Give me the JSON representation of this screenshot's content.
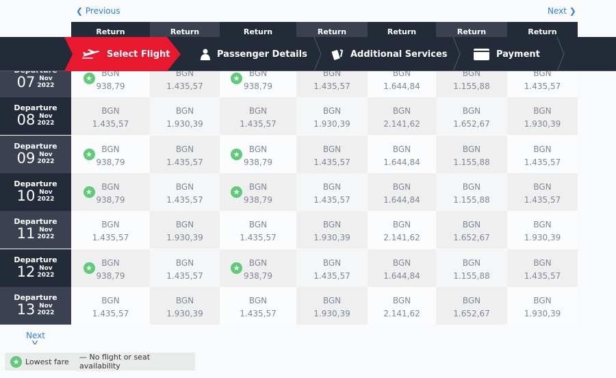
{
  "pagination": {
    "previous": "Previous",
    "next": "Next",
    "next_bottom": "Next"
  },
  "return_header": "Return",
  "steps": [
    {
      "label": "Select Flight",
      "icon": "airplane-icon",
      "active": true
    },
    {
      "label": "Passenger Details",
      "icon": "person-icon"
    },
    {
      "label": "Additional Services",
      "icon": "tickets-icon"
    },
    {
      "label": "Payment",
      "icon": "credit-card-icon"
    }
  ],
  "departure_label": "Departure",
  "currency": "BGN",
  "rows": [
    {
      "day": "07",
      "month": "Nov",
      "year": "2022",
      "fares": [
        "938,79",
        "1.435,57",
        "938,79",
        "1.435,57",
        "1.644,84",
        "1.155,88",
        "1.435,57"
      ],
      "lowest": [
        0,
        2
      ]
    },
    {
      "day": "08",
      "month": "Nov",
      "year": "2022",
      "fares": [
        "1.435,57",
        "1.930,39",
        "1.435,57",
        "1.930,39",
        "2.141,62",
        "1.652,67",
        "1.930,39"
      ],
      "lowest": []
    },
    {
      "day": "09",
      "month": "Nov",
      "year": "2022",
      "fares": [
        "938,79",
        "1.435,57",
        "938,79",
        "1.435,57",
        "1.644,84",
        "1.155,88",
        "1.435,57"
      ],
      "lowest": [
        0,
        2
      ]
    },
    {
      "day": "10",
      "month": "Nov",
      "year": "2022",
      "fares": [
        "938,79",
        "1.435,57",
        "938,79",
        "1.435,57",
        "1.644,84",
        "1.155,88",
        "1.435,57"
      ],
      "lowest": [
        0,
        2
      ]
    },
    {
      "day": "11",
      "month": "Nov",
      "year": "2022",
      "fares": [
        "1.435,57",
        "1.930,39",
        "1.435,57",
        "1.930,39",
        "2.141,62",
        "1.652,67",
        "1.930,39"
      ],
      "lowest": []
    },
    {
      "day": "12",
      "month": "Nov",
      "year": "2022",
      "fares": [
        "938,79",
        "1.435,57",
        "938,79",
        "1.435,57",
        "1.644,84",
        "1.155,88",
        "1.435,57"
      ],
      "lowest": [
        0,
        2
      ]
    },
    {
      "day": "13",
      "month": "Nov",
      "year": "2022",
      "fares": [
        "1.435,57",
        "1.930,39",
        "1.435,57",
        "1.930,39",
        "2.141,62",
        "1.652,67",
        "1.930,39"
      ],
      "lowest": []
    }
  ],
  "legend": {
    "lowest_fare": "Lowest fare",
    "no_availability": "— No flight or seat availability"
  },
  "colors": {
    "accent": "#e8192f",
    "nav": "#232a38",
    "lowest_star": "#5fca77",
    "link": "#2f7de1"
  }
}
